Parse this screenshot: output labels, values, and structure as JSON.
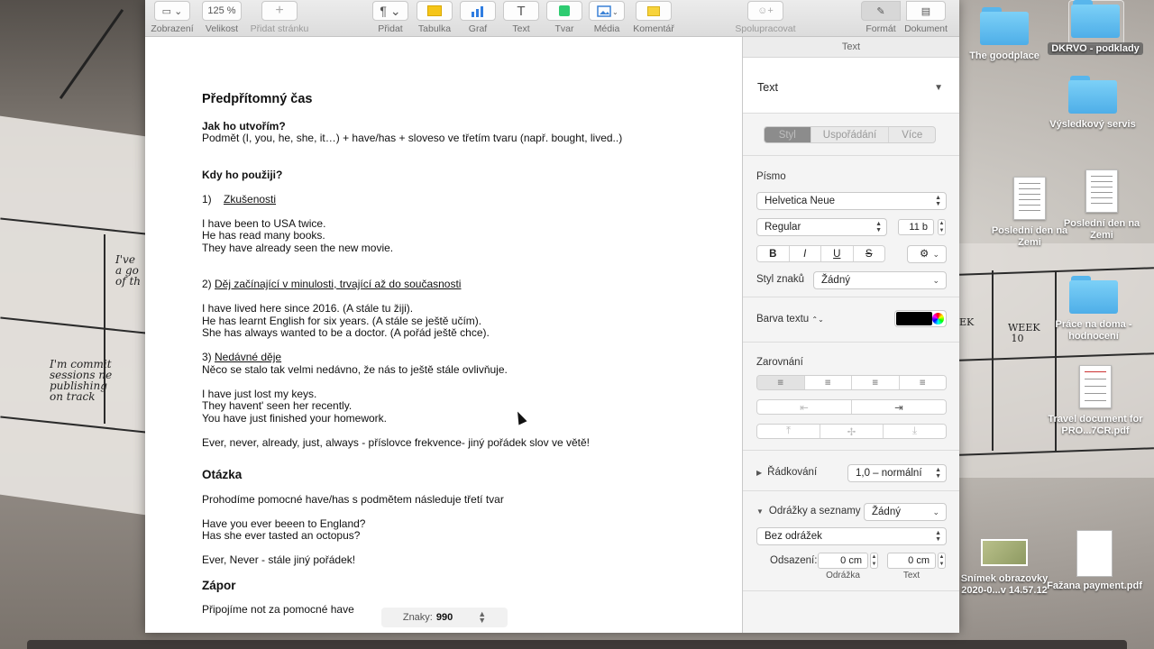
{
  "toolbar": {
    "view_label": "Zobrazení",
    "zoom_value": "125 %",
    "zoom_label": "Velikost",
    "add_page_label": "Přidat stránku",
    "insert_label": "Přidat",
    "table_label": "Tabulka",
    "chart_label": "Graf",
    "text_label": "Text",
    "shape_label": "Tvar",
    "media_label": "Média",
    "comment_label": "Komentář",
    "collaborate_label": "Spolupracovat",
    "format_label": "Formát",
    "document_label": "Dokument"
  },
  "document": {
    "title": "Předpřítomný čas",
    "how_heading": "Jak ho utvořím?",
    "how_text": "Podmět (I, you, he, she, it…) + have/has + sloveso ve třetím tvaru (např. bought, lived..)",
    "when_heading": "Kdy ho použiji?",
    "s1_num": "1)",
    "s1_title": "Zkušenosti",
    "s1_lines": [
      "I have been to USA twice.",
      "He has read many books.",
      "They have already seen the new movie."
    ],
    "s2_num": "2)",
    "s2_title": "Děj začínající v minulosti, trvající až do současnosti",
    "s2_lines": [
      "I have lived here since 2016. (A stále tu žiji).",
      "He has learnt English for six years. (A stále se ještě učím).",
      "She has always wanted to be a doctor. (A pořád ještě chce)."
    ],
    "s3_num": "3)",
    "s3_title": "Nedávné děje",
    "s3_desc": "Něco se stalo tak velmi nedávno, že nás to ještě stále ovlivňuje.",
    "s3_lines": [
      "I have just lost my keys.",
      "They havent' seen her recently.",
      "You have just finished your homework."
    ],
    "adverbs": "Ever, never, already, just, always - příslovce frekvence-  jiný pořádek slov ve větě!",
    "question_heading": "Otázka",
    "question_text": "Prohodíme pomocné have/has s podmětem následuje třetí tvar",
    "question_lines": [
      "Have you ever beeen to England?",
      "Has she ever tasted an octopus?"
    ],
    "question_note": "Ever, Never - stále jiný pořádek!",
    "negative_heading": "Zápor",
    "negative_text": "Připojíme not za pomocné have"
  },
  "char_count": {
    "label": "Znaky:",
    "value": "990"
  },
  "inspector": {
    "title": "Text",
    "paragraph_style": "Text",
    "tabs": [
      "Styl",
      "Uspořádání",
      "Více"
    ],
    "font_heading": "Písmo",
    "font_family": "Helvetica Neue",
    "font_weight": "Regular",
    "font_size": "11 b",
    "format_buttons": [
      "B",
      "I",
      "U",
      "S"
    ],
    "char_style_label": "Styl znaků",
    "char_style_value": "Žádný",
    "text_color_label": "Barva textu",
    "text_color": "#000000",
    "alignment_heading": "Zarovnání",
    "line_spacing_label": "Řádkování",
    "line_spacing_value": "1,0 – normální",
    "bullets_label": "Odrážky a seznamy",
    "bullets_value": "Žádný",
    "bullet_type": "Bez odrážek",
    "indent_label": "Odsazení:",
    "indent_bullet": "0 cm",
    "indent_text": "0 cm",
    "indent_bullet_caption": "Odrážka",
    "indent_text_caption": "Text"
  },
  "desktop_icons": [
    "The goodplace",
    "DKRVO - podklady",
    "Výsledkový servis",
    "Poslední den na Zemi",
    "Poslední den na Zemi",
    "Práce na doma - hodnocení",
    "Travel document for  PRO...7CR.pdf",
    "Snímek obrazovky 2020-0...v 14.57.12",
    "Fažana payment.pdf"
  ]
}
